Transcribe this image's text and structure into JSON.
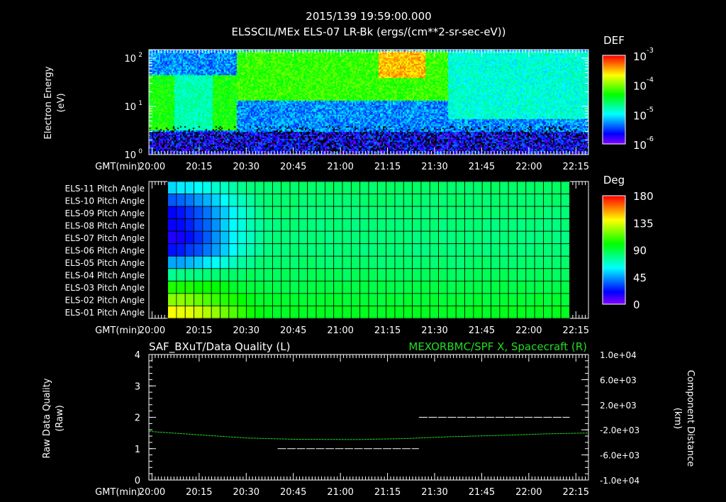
{
  "header": {
    "timestamp": "2015/139 19:59:00.000",
    "title": "ELSSCIL/MEx ELS-07 LR-Bk  (ergs/(cm**2-sr-sec-eV))"
  },
  "time_axis": {
    "label": "GMT(min)",
    "start": "19:59",
    "end": "22:19",
    "ticks": [
      "20:00",
      "20:15",
      "20:30",
      "20:45",
      "21:00",
      "21:15",
      "21:30",
      "21:45",
      "22:00",
      "22:15"
    ]
  },
  "chart_data": [
    {
      "type": "heatmap",
      "name": "spectrogram",
      "ylabel": "Electron Energy",
      "yunit": "(eV)",
      "yscale": "log",
      "ylim": [
        1,
        145
      ],
      "yticks": [
        {
          "base": "10",
          "exp": "0",
          "value": 1
        },
        {
          "base": "10",
          "exp": "1",
          "value": 10
        },
        {
          "base": "10",
          "exp": "2",
          "value": 100
        }
      ],
      "colorbar": {
        "title": "DEF",
        "log_range": [
          -6,
          -3
        ],
        "ticks": [
          {
            "base": "10",
            "exp": "-3",
            "value": -3
          },
          {
            "base": "10",
            "exp": "-4",
            "value": -4
          },
          {
            "base": "10",
            "exp": "-5",
            "value": -5
          },
          {
            "base": "10",
            "exp": "-6",
            "value": -6
          }
        ]
      },
      "regions": [
        {
          "from": "19:59",
          "to": "20:07",
          "band_eV": [
            3.2,
            45
          ],
          "log_def": -4.3
        },
        {
          "from": "20:07",
          "to": "20:19",
          "band_eV": [
            3.2,
            45
          ],
          "log_def": -4.8
        },
        {
          "from": "20:19",
          "to": "20:27",
          "band_eV": [
            3.2,
            45
          ],
          "log_def": -4.3
        },
        {
          "from": "20:27",
          "to": "21:34",
          "band_eV": [
            14,
            145
          ],
          "log_def": -4.2
        },
        {
          "from": "21:12",
          "to": "21:27",
          "band_eV": [
            40,
            145
          ],
          "log_def": -3.5
        },
        {
          "from": "21:34",
          "to": "22:19",
          "band_eV": [
            5.6,
            145
          ],
          "log_def": -4.9
        }
      ]
    },
    {
      "type": "heatmap",
      "name": "pitch-angle",
      "colorbar": {
        "title": "Deg",
        "range": [
          0,
          180
        ],
        "ticks": [
          "180",
          "135",
          "90",
          "45",
          "0"
        ]
      },
      "time_range": [
        "20:05",
        "22:13"
      ],
      "transition": [
        "20:05",
        "20:40"
      ],
      "rows": [
        {
          "label": "ELS-11 Pitch Angle",
          "early": 55,
          "late": 84
        },
        {
          "label": "ELS-10 Pitch Angle",
          "early": 35,
          "late": 83
        },
        {
          "label": "ELS-09 Pitch Angle",
          "early": 20,
          "late": 82
        },
        {
          "label": "ELS-08 Pitch Angle",
          "early": 18,
          "late": 81
        },
        {
          "label": "ELS-07 Pitch Angle",
          "early": 15,
          "late": 81
        },
        {
          "label": "ELS-06 Pitch Angle",
          "early": 22,
          "late": 81
        },
        {
          "label": "ELS-05 Pitch Angle",
          "early": 45,
          "late": 83
        },
        {
          "label": "ELS-04 Pitch Angle",
          "early": 78,
          "late": 86
        },
        {
          "label": "ELS-03 Pitch Angle",
          "early": 105,
          "late": 89
        },
        {
          "label": "ELS-02 Pitch Angle",
          "early": 122,
          "late": 92
        },
        {
          "label": "ELS-01 Pitch Angle",
          "early": 140,
          "late": 95
        }
      ]
    },
    {
      "type": "line",
      "name": "quality-and-position",
      "left_title": "SAF_BXuT/Data Quality (L)",
      "right_title": "MEXORBMC/SPF X, Spacecraft (R)",
      "left_label": "Raw Data Quality",
      "left_unit": "(Raw)",
      "right_label": "Component Distance",
      "right_unit": "(km)",
      "left_ylim": [
        0,
        4
      ],
      "left_ticks": [
        "0",
        "1",
        "2",
        "3",
        "4"
      ],
      "right_ylim": [
        -10000,
        10000
      ],
      "right_ticks": [
        "-1.0e+04",
        "-6.0e+03",
        "-2.0e+03",
        "2.0e+03",
        "6.0e+03",
        "1.0e+04"
      ],
      "quality_segments": [
        {
          "from": "20:05",
          "to": "20:40",
          "value": 0
        },
        {
          "from": "20:40",
          "to": "21:25",
          "value": 1
        },
        {
          "from": "21:25",
          "to": "22:13",
          "value": 2
        }
      ],
      "position_series": {
        "color": "#22dd22",
        "points": [
          {
            "t": "19:59",
            "km": -2250
          },
          {
            "t": "20:15",
            "km": -2800
          },
          {
            "t": "20:30",
            "km": -3300
          },
          {
            "t": "20:45",
            "km": -3500
          },
          {
            "t": "21:05",
            "km": -3550
          },
          {
            "t": "21:20",
            "km": -3400
          },
          {
            "t": "21:35",
            "km": -3100
          },
          {
            "t": "21:50",
            "km": -2900
          },
          {
            "t": "22:05",
            "km": -2650
          },
          {
            "t": "22:19",
            "km": -2500
          }
        ]
      }
    }
  ]
}
